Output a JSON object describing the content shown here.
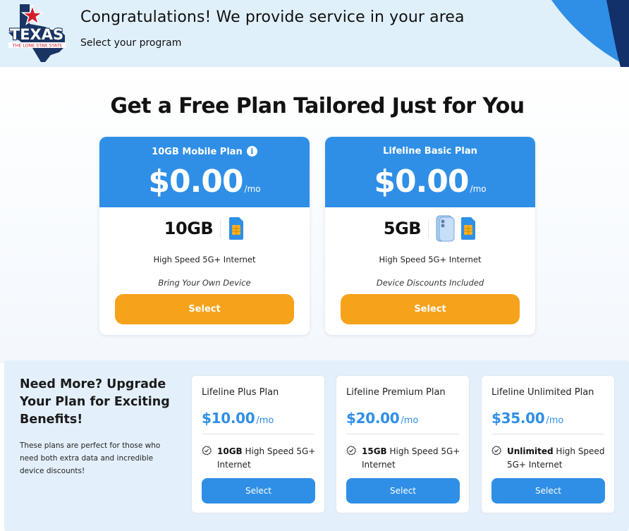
{
  "header": {
    "logo_text": "TEXAS",
    "logo_subtext": "THE LONE STAR STATE",
    "title": "Congratulations! We provide service in your area",
    "subtitle": "Select your program"
  },
  "headline": "Get a Free Plan Tailored Just for You",
  "free_plans": [
    {
      "name": "10GB Mobile Plan",
      "has_info": true,
      "price": "$0.00",
      "per": "/mo",
      "data": "10GB",
      "icons": [
        "sim-card-icon"
      ],
      "feature": "High Speed 5G+ Internet",
      "note": "Bring Your Own Device",
      "button": "Select"
    },
    {
      "name": "Lifeline Basic Plan",
      "has_info": false,
      "price": "$0.00",
      "per": "/mo",
      "data": "5GB",
      "icons": [
        "phone-icon",
        "sim-card-icon"
      ],
      "feature": "High Speed 5G+ Internet",
      "note": "Device Discounts Included",
      "button": "Select"
    }
  ],
  "upgrade": {
    "title": "Need More? Upgrade Your Plan for Exciting Benefits!",
    "description": "These plans are perfect for those who need both extra data and incredible device discounts!",
    "plans": [
      {
        "name": "Lifeline Plus Plan",
        "price": "$10.00",
        "per": "/mo",
        "feature_bold": "10GB",
        "feature_rest": " High Speed 5G+ Internet",
        "button": "Select"
      },
      {
        "name": "Lifeline Premium Plan",
        "price": "$20.00",
        "per": "/mo",
        "feature_bold": "15GB",
        "feature_rest": " High Speed 5G+ Internet",
        "button": "Select"
      },
      {
        "name": "Lifeline Unlimited Plan",
        "price": "$35.00",
        "per": "/mo",
        "feature_bold": "Unlimited",
        "feature_rest": " High Speed 5G+ Internet",
        "button": "Select"
      }
    ]
  },
  "colors": {
    "header_bg": "#dff0fb",
    "primary_blue": "#2f8fe6",
    "accent_orange": "#f7a21b",
    "texas_navy": "#1a3563",
    "texas_red": "#d4202e"
  }
}
